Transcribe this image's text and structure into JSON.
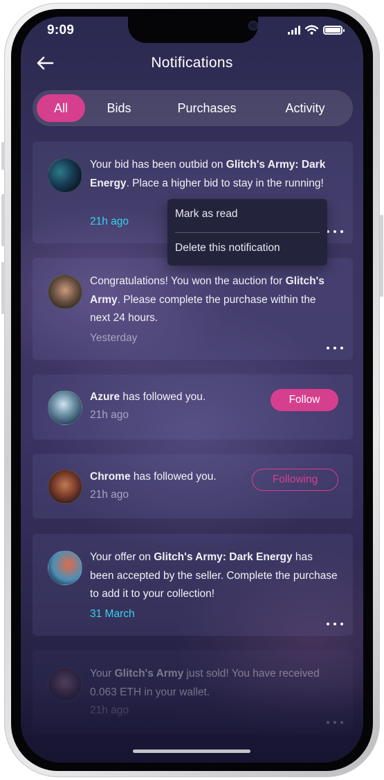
{
  "status_bar": {
    "time": "9:09"
  },
  "header": {
    "title": "Notifications"
  },
  "tabs": [
    {
      "label": "All",
      "active": true
    },
    {
      "label": "Bids",
      "active": false
    },
    {
      "label": "Purchases",
      "active": false
    },
    {
      "label": "Activity",
      "active": false
    }
  ],
  "notifications": [
    {
      "parts": [
        "Your bid has been outbid on ",
        "Glitch's Army: Dark Energy",
        ". Place a higher bid to stay in the running!"
      ],
      "time": "21h ago"
    },
    {
      "parts": [
        "Congratulations! You won the auction for ",
        "Glitch's Army",
        ". Please complete the purchase within the next 24 hours."
      ],
      "time": "Yesterday"
    },
    {
      "parts": [
        "Azure",
        " has followed you."
      ],
      "time": "21h ago",
      "action": "Follow"
    },
    {
      "parts": [
        "Chrome",
        " has followed you."
      ],
      "time": "21h ago",
      "action": "Following"
    },
    {
      "parts": [
        "Your offer on ",
        "Glitch's Army: Dark Energy",
        " has been accepted by the seller. Complete the purchase to add it to your collection!"
      ],
      "time": "31 March"
    },
    {
      "parts": [
        "Your ",
        "Glitch's Army",
        " just sold! You have received 0.063 ETH in your wallet."
      ],
      "time": "21h ago"
    }
  ],
  "context_menu": {
    "mark_read": "Mark as read",
    "delete": "Delete this notification"
  },
  "colors": {
    "accent": "#d63f8d",
    "time_highlight": "#35d3ec",
    "time_muted": "#a7a5c4"
  }
}
